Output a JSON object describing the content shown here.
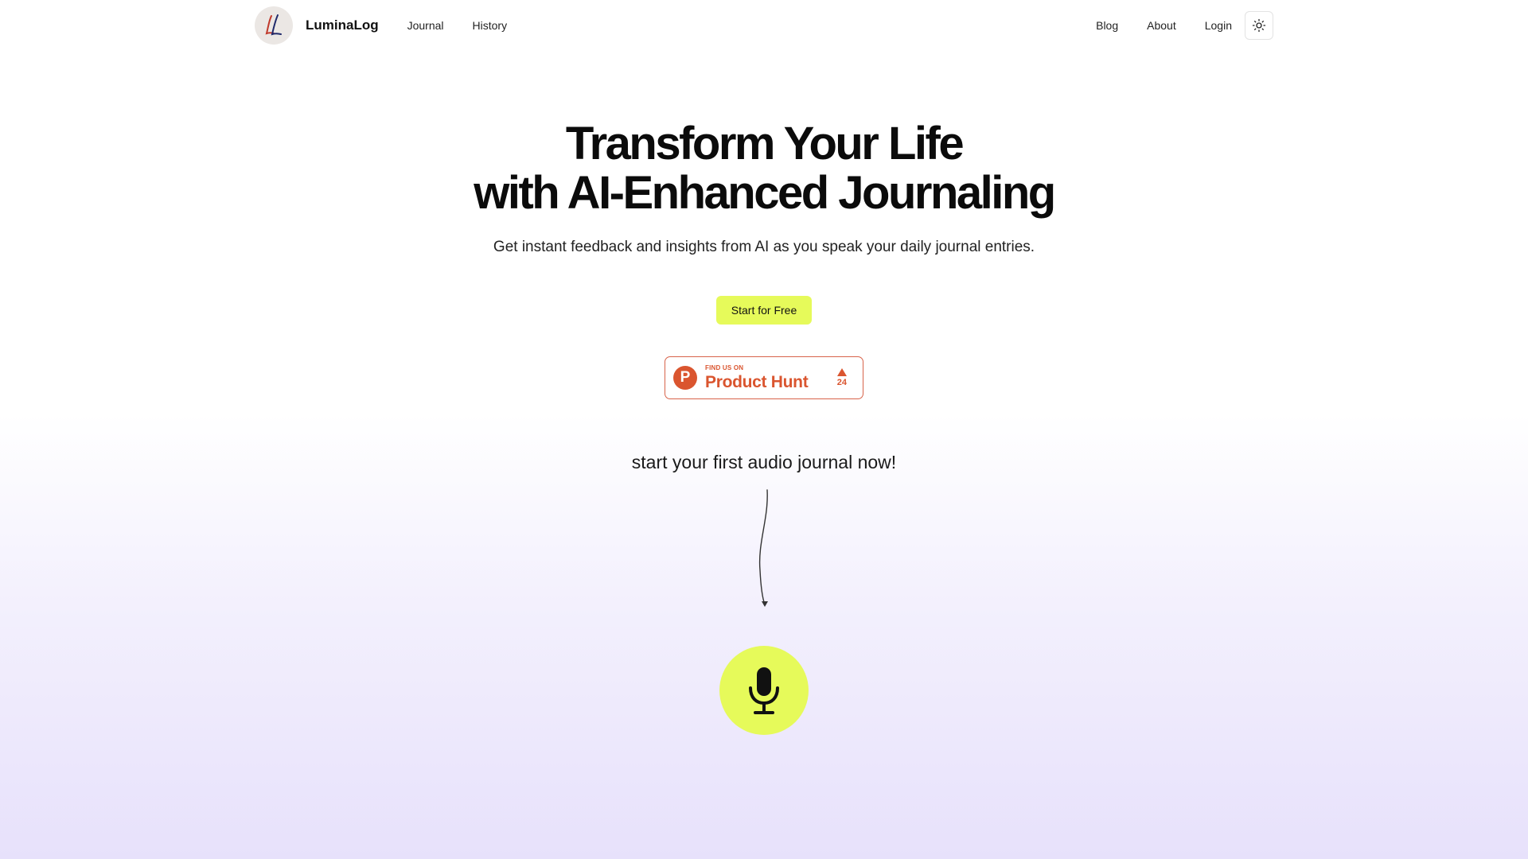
{
  "header": {
    "brand": "LuminaLog",
    "logo_icon": "ll-monogram-logo",
    "nav_left": [
      {
        "label": "Journal"
      },
      {
        "label": "History"
      }
    ],
    "nav_right": [
      {
        "label": "Blog"
      },
      {
        "label": "About"
      },
      {
        "label": "Login"
      }
    ],
    "theme_toggle_icon": "sun-icon"
  },
  "hero": {
    "title_line1": "Transform Your Life",
    "title_line2": "with AI-Enhanced Journaling",
    "subtitle": "Get instant feedback and insights from AI as you speak your daily journal entries.",
    "cta_label": "Start for Free"
  },
  "product_hunt": {
    "small_text": "FIND US ON",
    "big_text": "Product Hunt",
    "logo_letter": "P",
    "upvotes": "24",
    "icon": "upvote-triangle-icon"
  },
  "prompt": {
    "text": "start your first audio journal now!",
    "arrow_icon": "curved-arrow-down-icon"
  },
  "mic": {
    "icon": "microphone-icon"
  },
  "colors": {
    "accent": "#e6fa5a",
    "product_hunt": "#da552f",
    "gradient_bottom": "#e7e1fb"
  }
}
